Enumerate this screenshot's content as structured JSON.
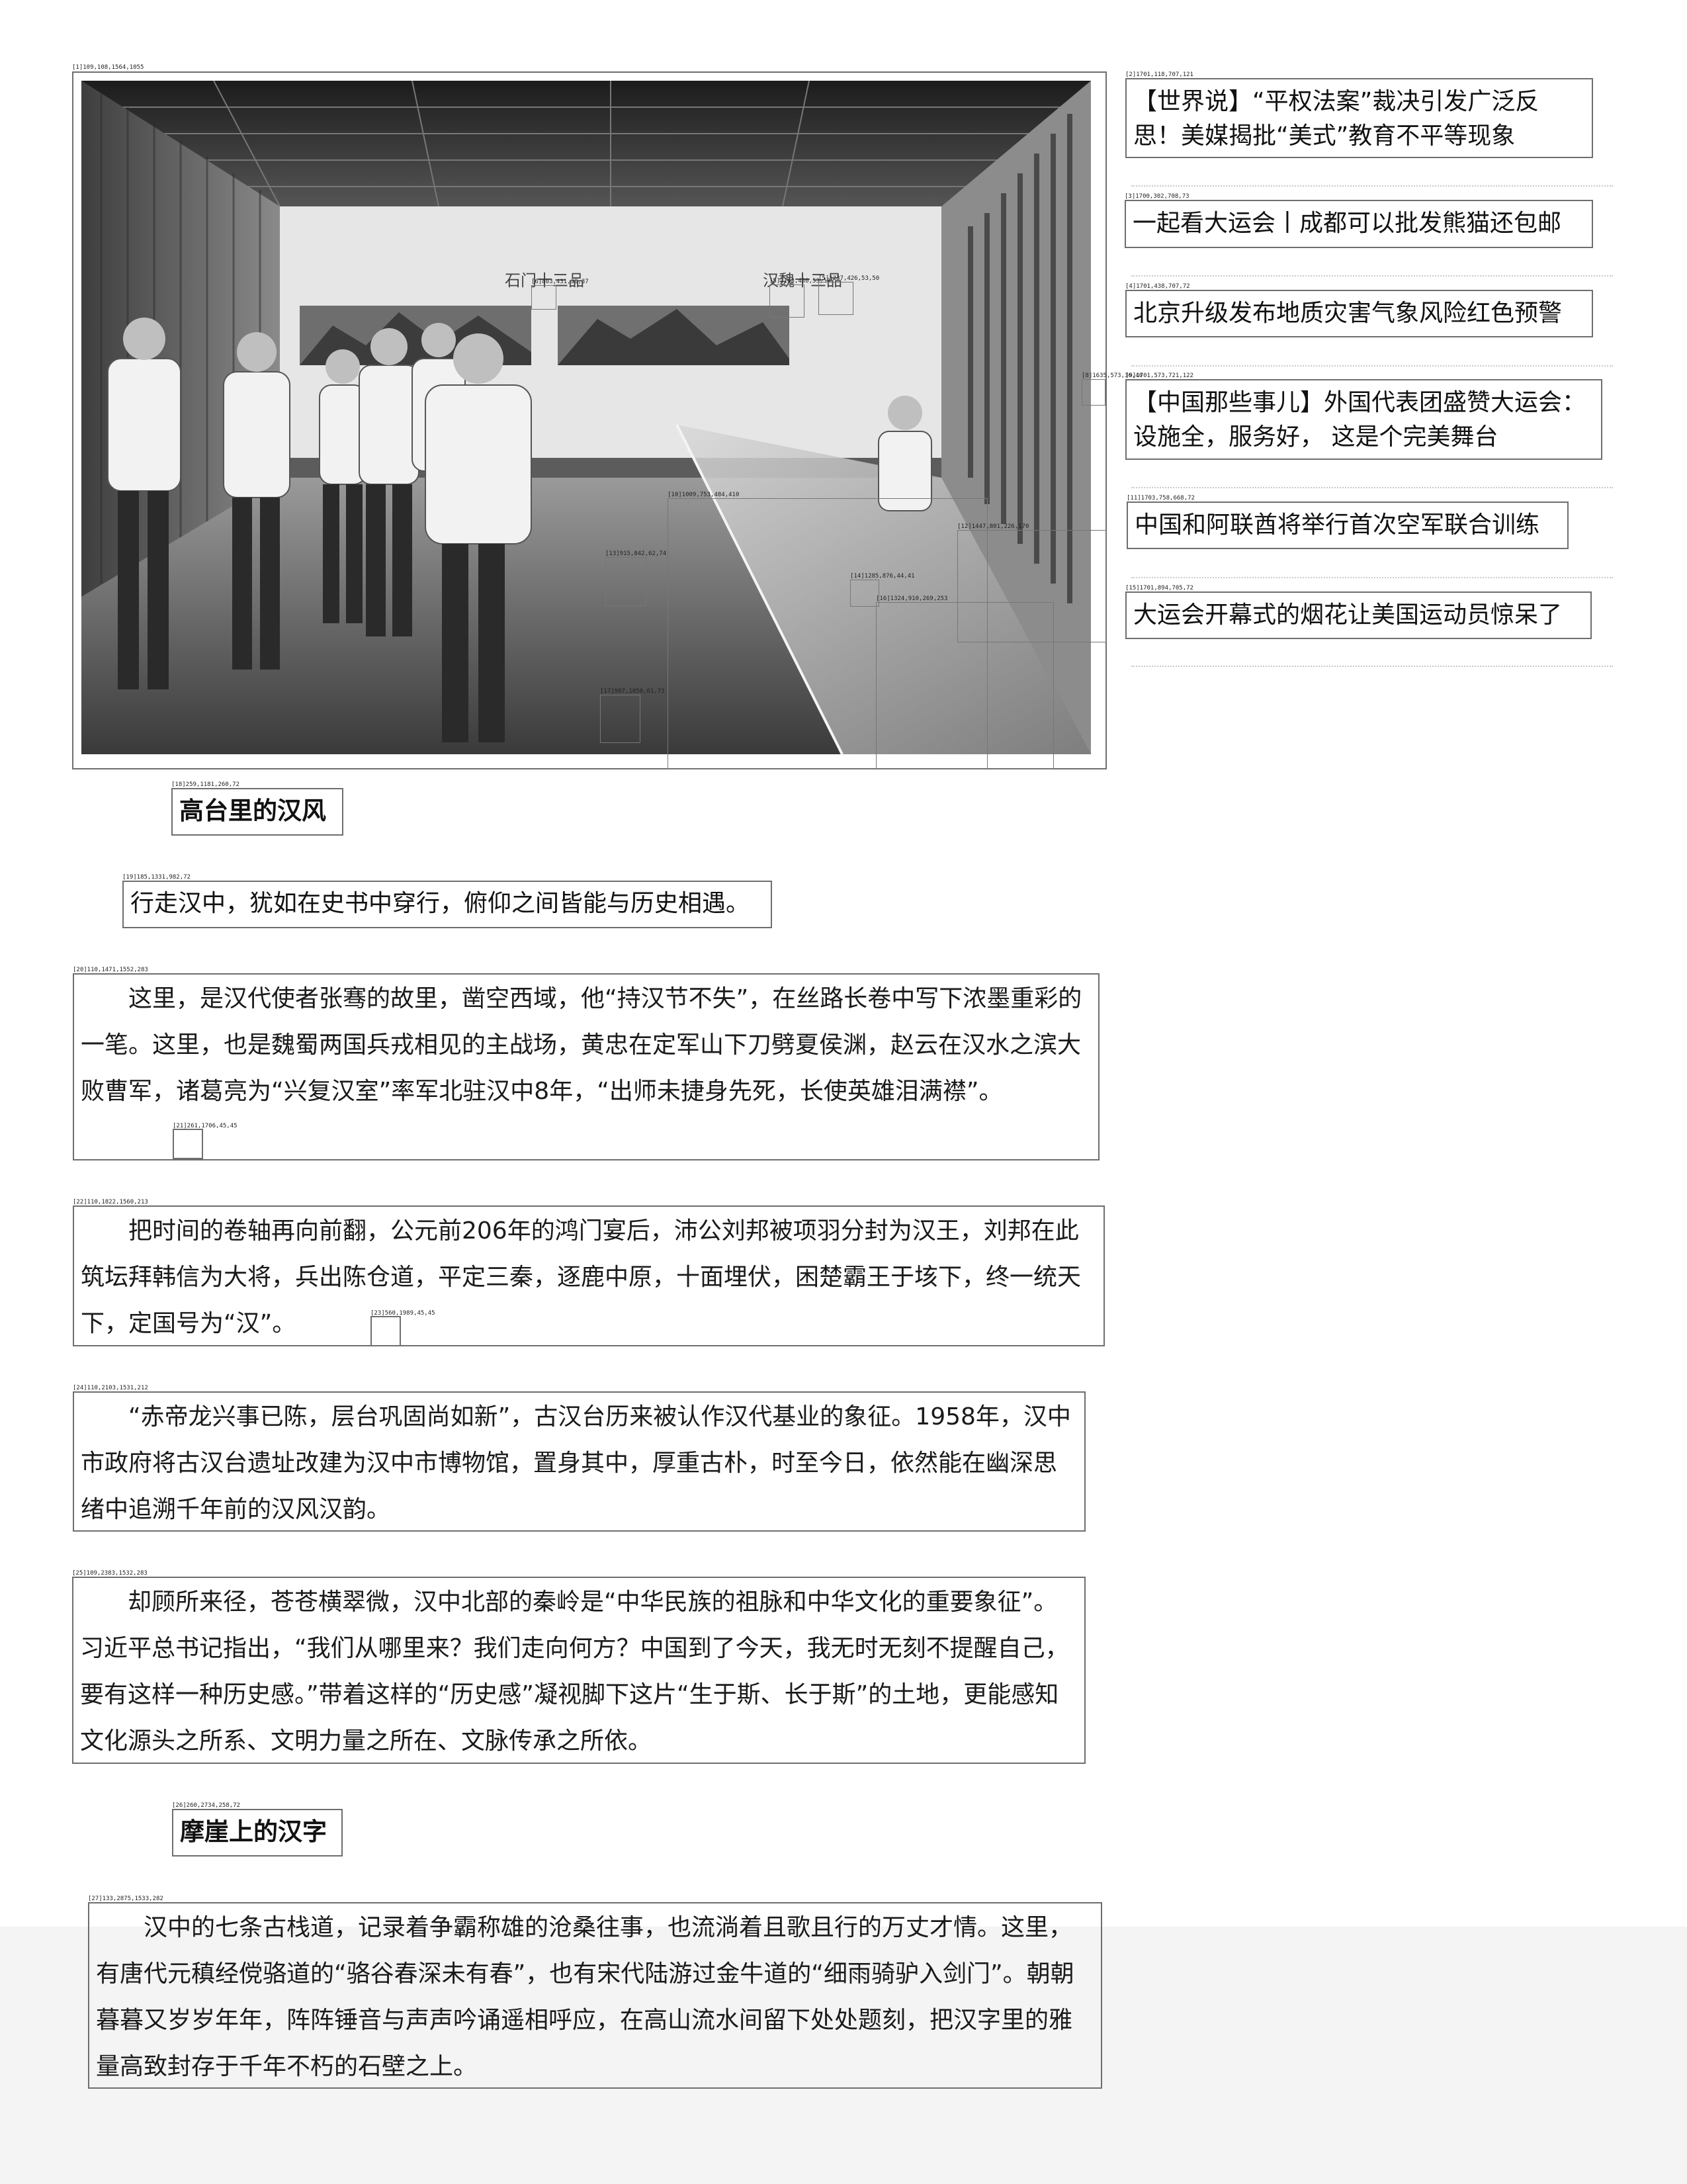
{
  "labels": {
    "l1": "[1]109,108,1564,1055",
    "l2": "[2]1701,118,707,121",
    "l3": "[3]1700,302,708,73",
    "l4": "[4]1701,438,707,72",
    "l5": "[5]1163,430,53,50",
    "l5b": "[5]1237,426,53,50",
    "l6": "[6]803,431,38,37",
    "l8": "[8]1635,573,36,40",
    "l9": "[9]1701,573,721,122",
    "l10": "[10]1009,753,484,410",
    "l11": "[11]1703,758,668,72",
    "l12": "[12]1447,801,226,170",
    "l13": "[13]915,842,62,74",
    "l14": "[14]1285,876,44,41",
    "l15": "[15]1701,894,705,72",
    "l16": "[16]1324,910,269,253",
    "l17": "[17]907,1050,61,73",
    "l18": "[18]259,1181,260,72",
    "l19": "[19]185,1331,982,72",
    "l20": "[20]110,1471,1552,283",
    "l21": "[21]261,1706,45,45",
    "l22": "[22]110,1822,1560,213",
    "l23": "[23]560,1989,45,45",
    "l24": "[24]110,2103,1531,212",
    "l25": "[25]109,2383,1532,283",
    "l26": "[26]260,2734,258,72",
    "l27": "[27]133,2875,1533,282"
  },
  "photo": {
    "sign_left": "石门十三品",
    "sign_right": "汉魏十三品"
  },
  "news": [
    "【世界说】“平权法案”裁决引发广泛反思！美媒揭批“美式”教育不平等现象",
    "一起看大运会丨成都可以批发熊猫还包邮",
    "北京升级发布地质灾害气象风险红色预警",
    "【中国那些事儿】外国代表团盛赞大运会：设施全，服务好， 这是个完美舞台",
    "中国和阿联酋将举行首次空军联合训练",
    "大运会开幕式的烟花让美国运动员惊呆了"
  ],
  "article": {
    "heading1": "高台里的汉风",
    "subtitle": "行走汉中，犹如在史书中穿行，俯仰之间皆能与历史相遇。",
    "p1": "这里，是汉代使者张骞的故里，凿空西域，他“持汉节不失”，在丝路长卷中写下浓墨重彩的一笔。这里，也是魏蜀两国兵戎相见的主战场，黄忠在定军山下刀劈夏侯渊，赵云在汉水之滨大败曹军，诸葛亮为“兴复汉室”率军北驻汉中8年，“出师未捷身先死，长使英雄泪满襟”。",
    "p2": "把时间的卷轴再向前翻，公元前206年的鸿门宴后，沛公刘邦被项羽分封为汉王，刘邦在此筑坛拜韩信为大将，兵出陈仓道，平定三秦，逐鹿中原，十面埋伏，困楚霸王于垓下，终一统天下，定国号为“汉”。",
    "p3": "“赤帝龙兴事已陈，层台巩固尚如新”，古汉台历来被认作汉代基业的象征。1958年，汉中市政府将古汉台遗址改建为汉中市博物馆，置身其中，厚重古朴，时至今日，依然能在幽深思绪中追溯千年前的汉风汉韵。",
    "p4": "却顾所来径，苍苍横翠微，汉中北部的秦岭是“中华民族的祖脉和中华文化的重要象征”。习近平总书记指出，“我们从哪里来？我们走向何方？中国到了今天，我无时无刻不提醒自己，要有这样一种历史感。”带着这样的“历史感”凝视脚下这片“生于斯、长于斯”的土地，更能感知文化源头之所系、文明力量之所在、文脉传承之所依。",
    "heading2": "摩崖上的汉字",
    "p5": "汉中的七条古栈道，记录着争霸称雄的沧桑往事，也流淌着且歌且行的万丈才情。这里，有唐代元稹经傥骆道的“骆谷春深未有春”，也有宋代陆游过金牛道的“细雨骑驴入剑门”。朝朝暮暮又岁岁年年，阵阵锤音与声声吟诵遥相呼应，在高山流水间留下处处题刻，把汉字里的雅量高致封存于千年不朽的石壁之上。"
  }
}
